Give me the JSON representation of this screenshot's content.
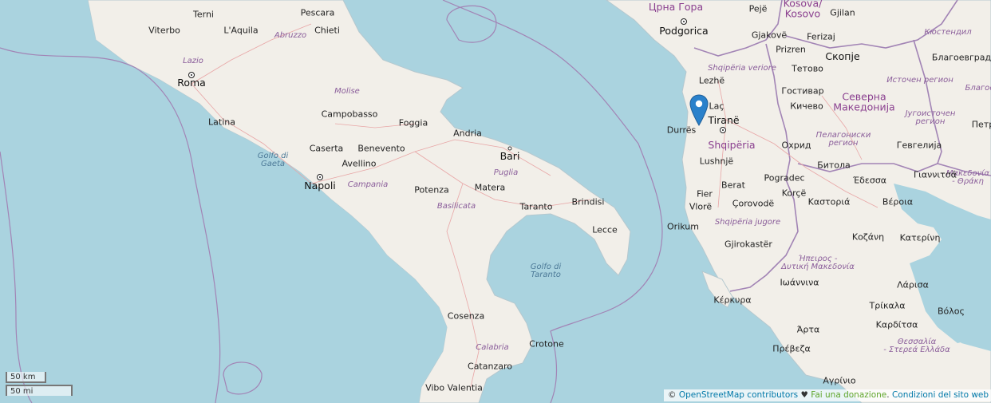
{
  "map": {
    "labels": {
      "terni": "Terni",
      "pescara": "Pescara",
      "viterbo": "Viterbo",
      "laquila": "L'Aquila",
      "chieti": "Chieti",
      "abruzzo": "Abruzzo",
      "lazio": "Lazio",
      "roma": "Roma",
      "molise": "Molise",
      "campobasso": "Campobasso",
      "latina": "Latina",
      "foggia": "Foggia",
      "andria": "Andria",
      "caserta": "Caserta",
      "benevento": "Benevento",
      "bari": "Bari",
      "golfo_gaeta": "Golfo di Gaeta",
      "avellino": "Avellino",
      "puglia": "Puglia",
      "napoli": "Napoli",
      "campania": "Campania",
      "potenza": "Potenza",
      "matera": "Matera",
      "brindisi": "Brindisi",
      "basilicata": "Basilicata",
      "taranto": "Taranto",
      "lecce": "Lecce",
      "golfo_taranto": "Golfo di Taranto",
      "cosenza": "Cosenza",
      "calabria": "Calabria",
      "crotone": "Crotone",
      "catanzaro": "Catanzaro",
      "vibo_valentia": "Vibo Valentia",
      "crna_gora": "Црна Гора",
      "podgorica": "Podgorica",
      "peje": "Pejë",
      "kosova": "Kosova/\nKosovo",
      "gjilan": "Gjilan",
      "gjakove": "Gjakovë",
      "ferizaj": "Ferizaj",
      "kyustendil": "Кюстендил",
      "prizren": "Prizren",
      "skopje": "Скопје",
      "blagoevgrad": "Благоевград",
      "shqiperia_veriore": "Shqipëria veriore",
      "tetovo": "Тетово",
      "lezhe": "Lezhë",
      "istochen": "Источен регион",
      "gostivar": "Гостивар",
      "sev_makedonija": "Северна\nМакедонија",
      "blagoe": "Благое",
      "lac": "Laç",
      "kichevo": "Кичево",
      "jugoistochen": "Југоисточен\nрегион",
      "durres": "Durrës",
      "tirane": "Tiranë",
      "petr": "Петр",
      "pelagoniski": "Пелагониски\nрегион",
      "shqiperia": "Shqipëria",
      "ohrid": "Охрид",
      "gevgelija": "Гевгелија",
      "lushnje": "Lushnjë",
      "bitola": "Битола",
      "makedonia": "Μακεδονία\n- Θράκη",
      "pogradec": "Pogradec",
      "giannitsa": "Γιαννιτσά",
      "edessa": "Έδεσσα",
      "berat": "Berat",
      "fier": "Fier",
      "korce": "Korçë",
      "kastoria": "Καστοριά",
      "veroia": "Βέροια",
      "corovode": "Çorovodë",
      "vlore": "Vlorë",
      "shqiperia_jugore": "Shqipëria jugore",
      "orikum": "Orikum",
      "kozani": "Κοζάνη",
      "katerini": "Κατερίνη",
      "gjirokaster": "Gjirokastër",
      "ipeiros": "Ήπειρος -\nΔυτική Μακεδονία",
      "ioannina": "Ιωάννινα",
      "kerkyra": "Κέρκυρα",
      "larisa": "Λάρισα",
      "trikala": "Τρίκαλα",
      "volos": "Βόλος",
      "karditsa": "Καρδίτσα",
      "arta": "Άρτα",
      "thessalia": "Θεσσαλία\n- Στερεά Ελλάδα",
      "preveza": "Πρέβεζα",
      "agrinio": "Αγρίνιο"
    },
    "marker_icon": "map-pin-icon",
    "colors": {
      "sea": "#aad3df",
      "land": "#f2efe9",
      "border": "#a284b5",
      "marker": "#2a81cb"
    }
  },
  "scale": {
    "km": "50 km",
    "mi": "50 mi"
  },
  "attribution": {
    "copyright": "©",
    "osm_link": "OpenStreetMap contributors",
    "heart": "♥",
    "donate": "Fai una donazione",
    "sep": ".",
    "terms": "Condizioni del sito web e de"
  }
}
